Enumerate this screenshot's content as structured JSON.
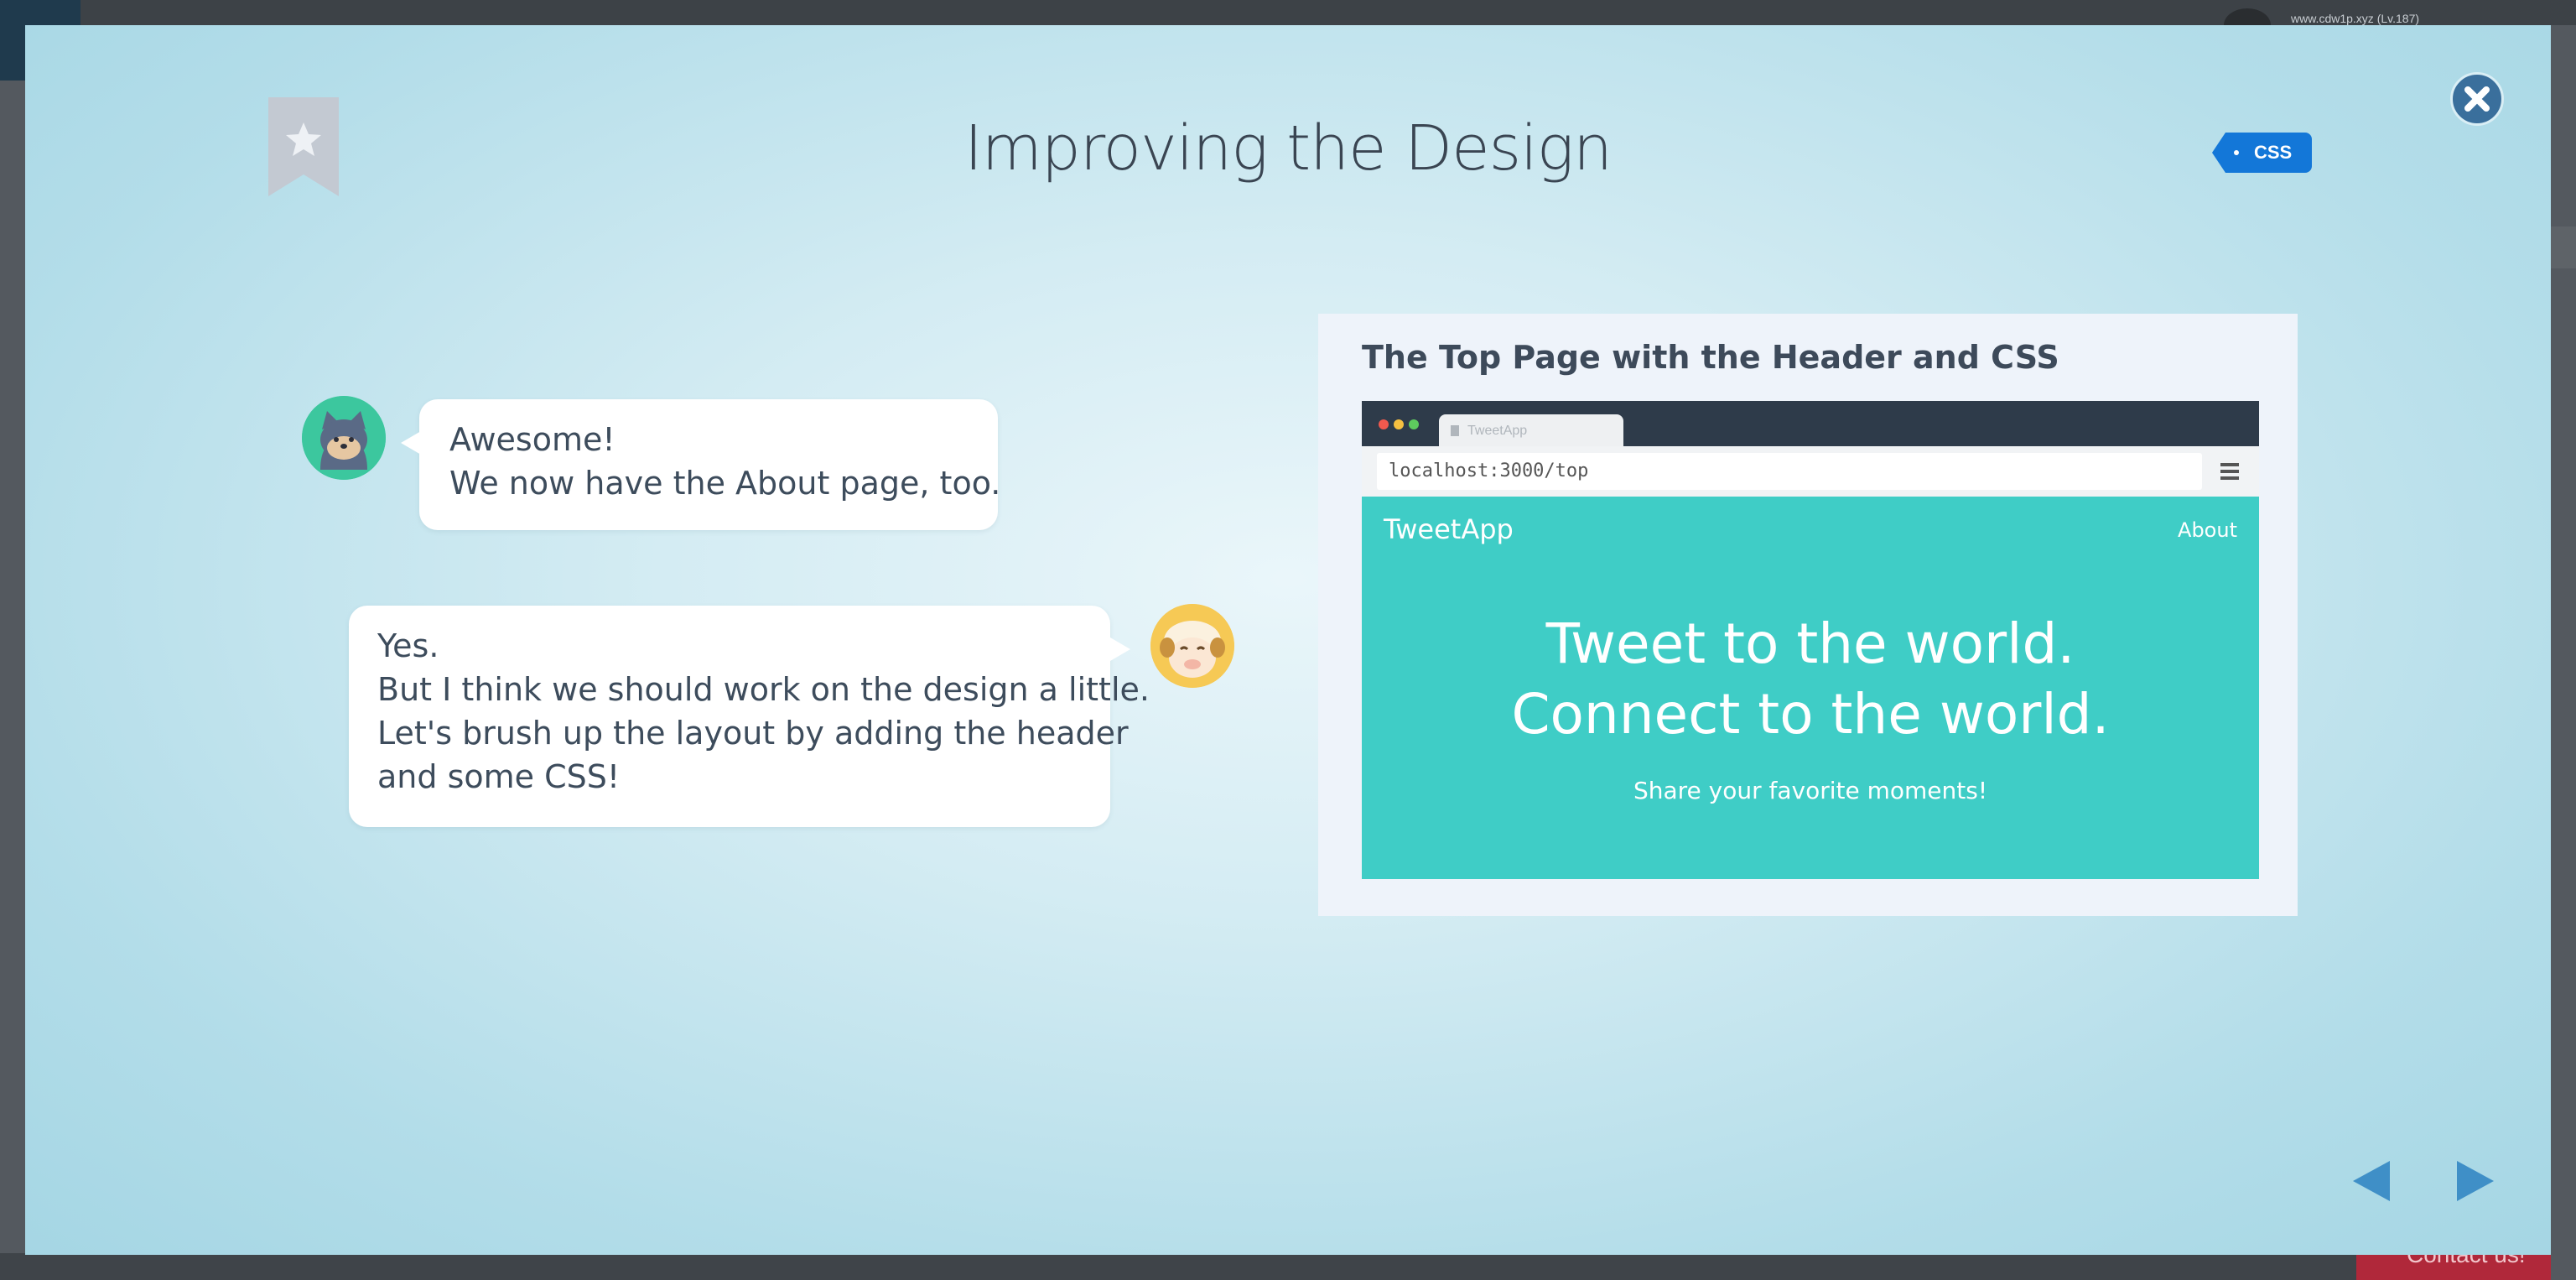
{
  "background": {
    "user_text": "www.cdw1p.xyz (Lv.187)",
    "contact_label": "Contact us!"
  },
  "modal": {
    "title": "Improving the Design",
    "tag": "CSS",
    "bookmark_icon": "star-icon",
    "close_icon": "close-icon"
  },
  "chat": {
    "message_1": {
      "speaker": "cat",
      "lines": [
        "Awesome!",
        "We now have the About page, too."
      ]
    },
    "message_2": {
      "speaker": "sheep",
      "lines": [
        "Yes.",
        "But I think we should work on the design a little.",
        "Let's brush up the layout by adding the header",
        "and some CSS!"
      ]
    }
  },
  "slide": {
    "title": "The Top Page with the Header and CSS",
    "browser": {
      "tab_label": "TweetApp",
      "url": "localhost:3000/top"
    },
    "site": {
      "brand": "TweetApp",
      "nav_about": "About",
      "hero_line_1": "Tweet to the world.",
      "hero_line_2": "Connect to the world.",
      "hero_sub": "Share your favorite moments!"
    }
  },
  "navigation": {
    "prev_icon": "triangle-left-icon",
    "next_icon": "triangle-right-icon"
  },
  "colors": {
    "tag": "#1377d8",
    "hero_bg": "#3fcdc6",
    "nav_arrow": "#3f8fc7",
    "close_button": "#3a6f9c"
  }
}
